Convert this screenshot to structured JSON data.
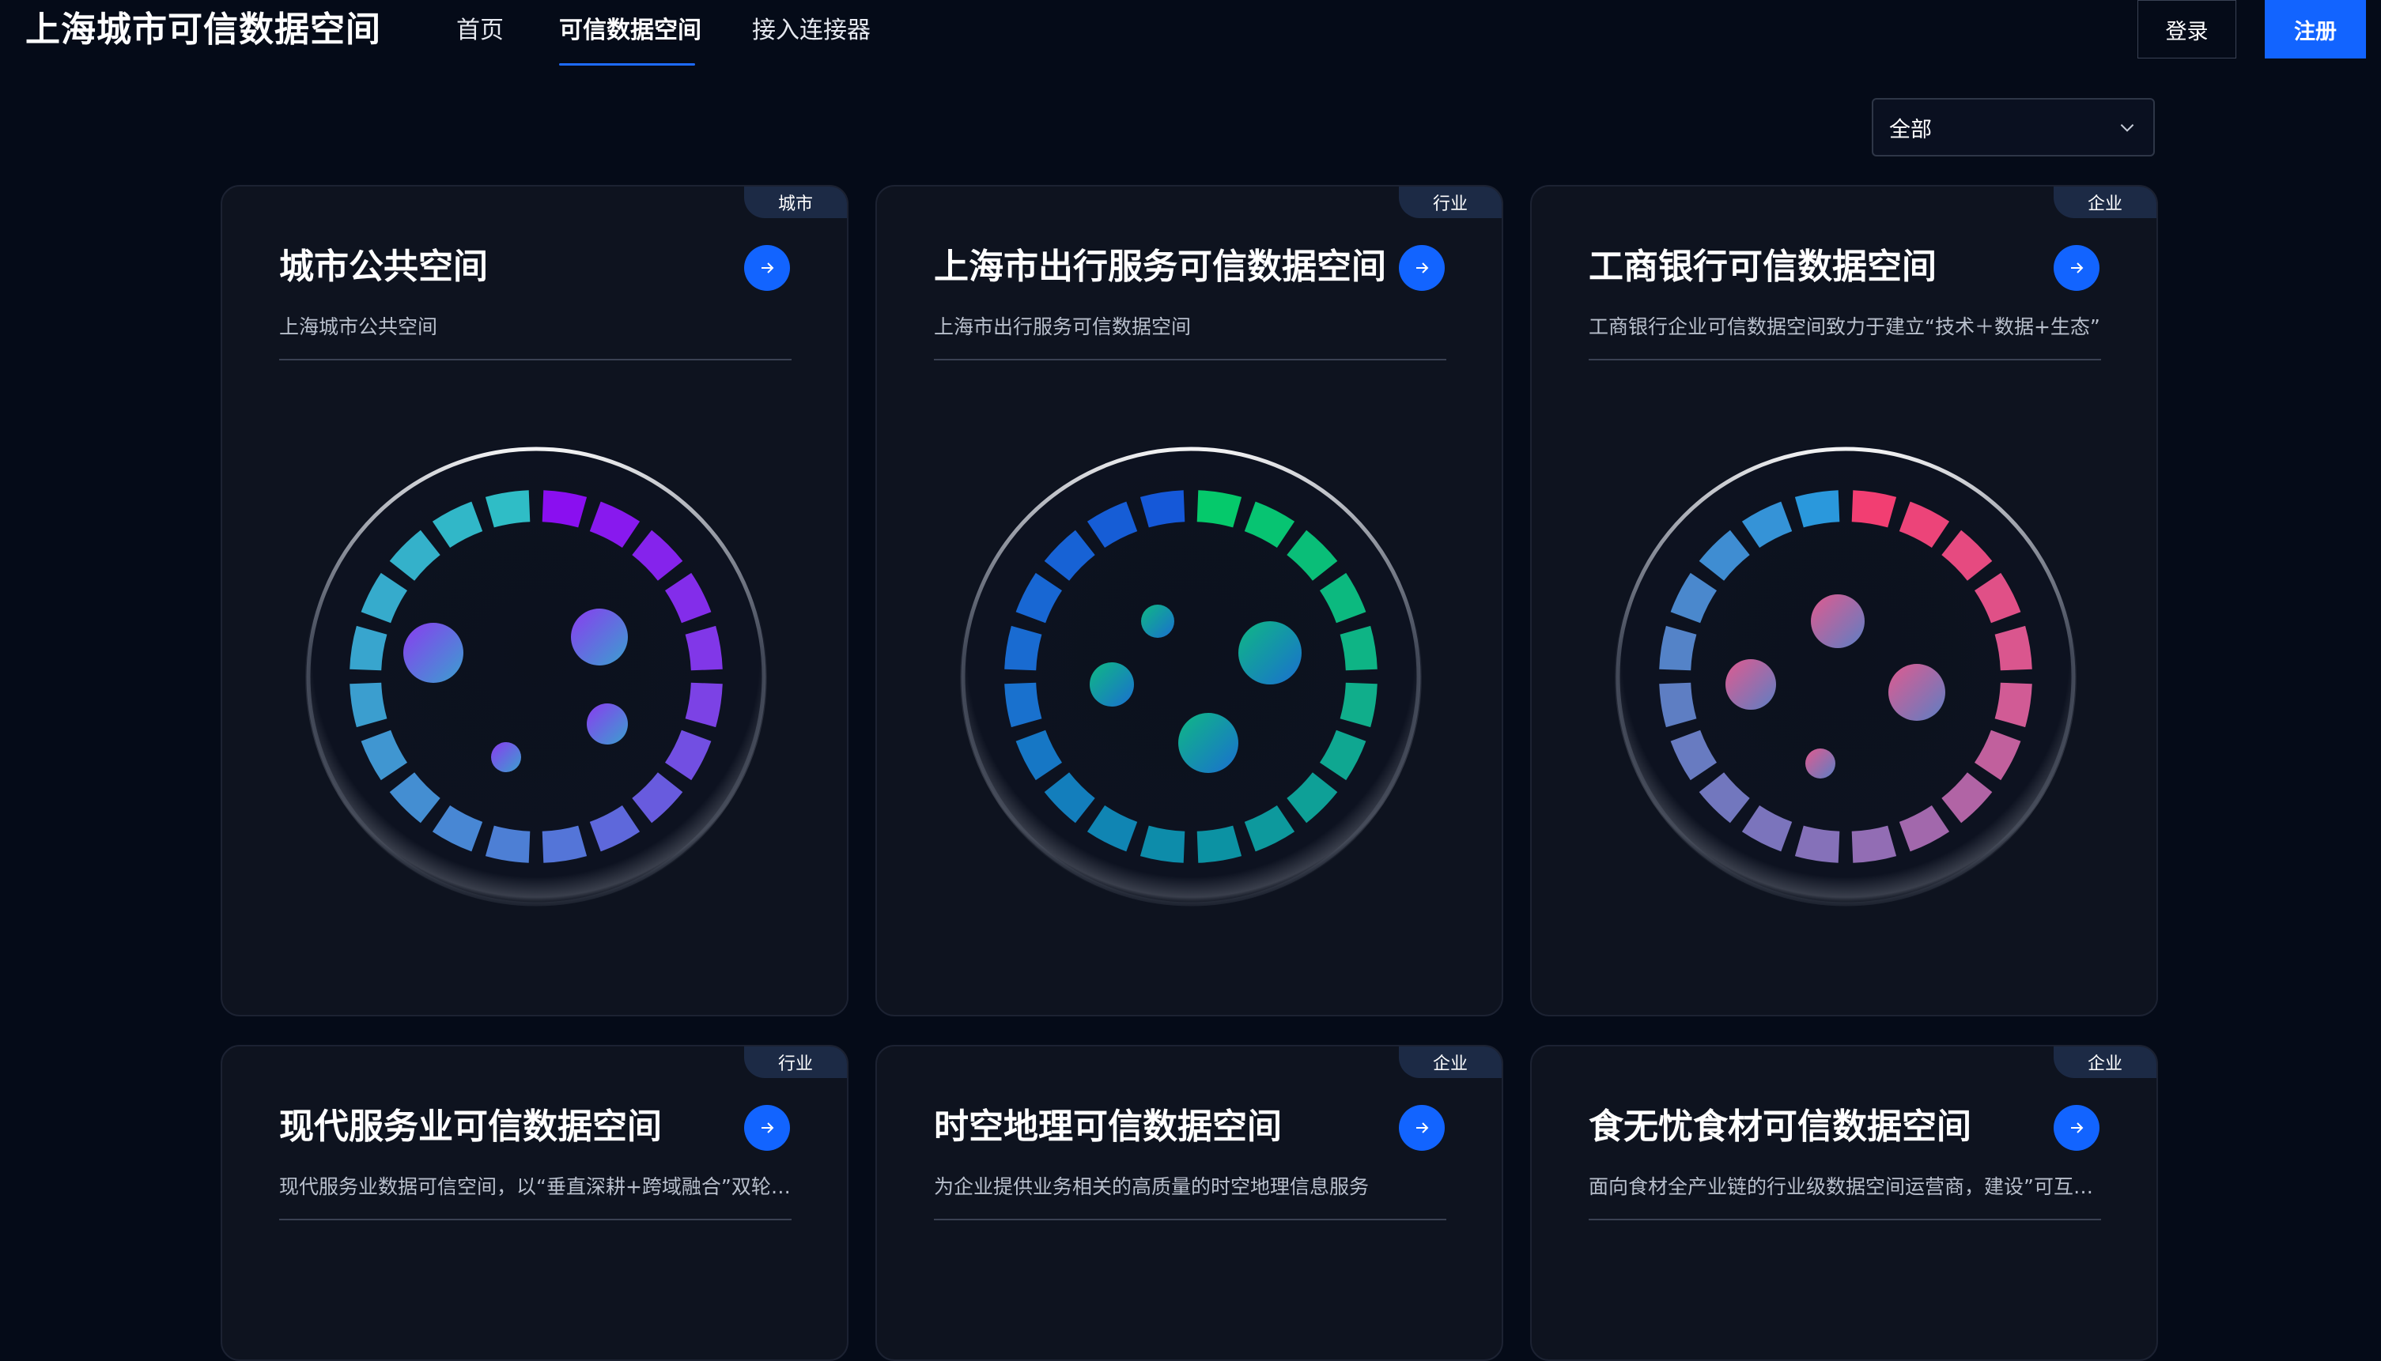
{
  "header": {
    "brand": "上海城市可信数据空间",
    "nav": [
      {
        "label": "首页",
        "active": false
      },
      {
        "label": "可信数据空间",
        "active": true
      },
      {
        "label": "接入连接器",
        "active": false
      }
    ],
    "login_label": "登录",
    "register_label": "注册"
  },
  "filter": {
    "selected": "全部",
    "icon": "chevron-down-icon"
  },
  "cards": [
    {
      "tag": "城市",
      "title": "城市公共空间",
      "desc": "上海城市公共空间",
      "ring_colors": [
        "#8a0ff0",
        "#7f3fe6",
        "#4f7bd6",
        "#3aa0cf",
        "#2fbdc6"
      ],
      "bubble_colors": [
        "#8a3cf0",
        "#3aa0cf"
      ]
    },
    {
      "tag": "行业",
      "title": "上海市出行服务可信数据空间",
      "desc": "上海市出行服务可信数据空间",
      "ring_colors": [
        "#05c96b",
        "#10b08a",
        "#0b8fa6",
        "#1a6fd0",
        "#1558d8"
      ],
      "bubble_colors": [
        "#0fb884",
        "#1a6fd0"
      ]
    },
    {
      "tag": "企业",
      "title": "工商银行可信数据空间",
      "desc": "工商银行企业可信数据空间致力于建立“技术＋数据+生态”",
      "ring_colors": [
        "#f23e72",
        "#d55a93",
        "#8a6fb8",
        "#5c7fc4",
        "#2a98dc"
      ],
      "bubble_colors": [
        "#e05a8f",
        "#5c7fc4"
      ]
    },
    {
      "tag": "行业",
      "title": "现代服务业可信数据空间",
      "desc": "现代服务业数据可信空间，以“垂直深耕+跨域融合”双轮驱动"
    },
    {
      "tag": "企业",
      "title": "时空地理可信数据空间",
      "desc": "为企业提供业务相关的高质量的时空地理信息服务"
    },
    {
      "tag": "企业",
      "title": "食无忧食材可信数据空间",
      "desc": "面向食材全产业链的行业级数据空间运营商，建设”可互联互通"
    }
  ],
  "icons": {
    "card_action": "arrow-right-icon"
  }
}
